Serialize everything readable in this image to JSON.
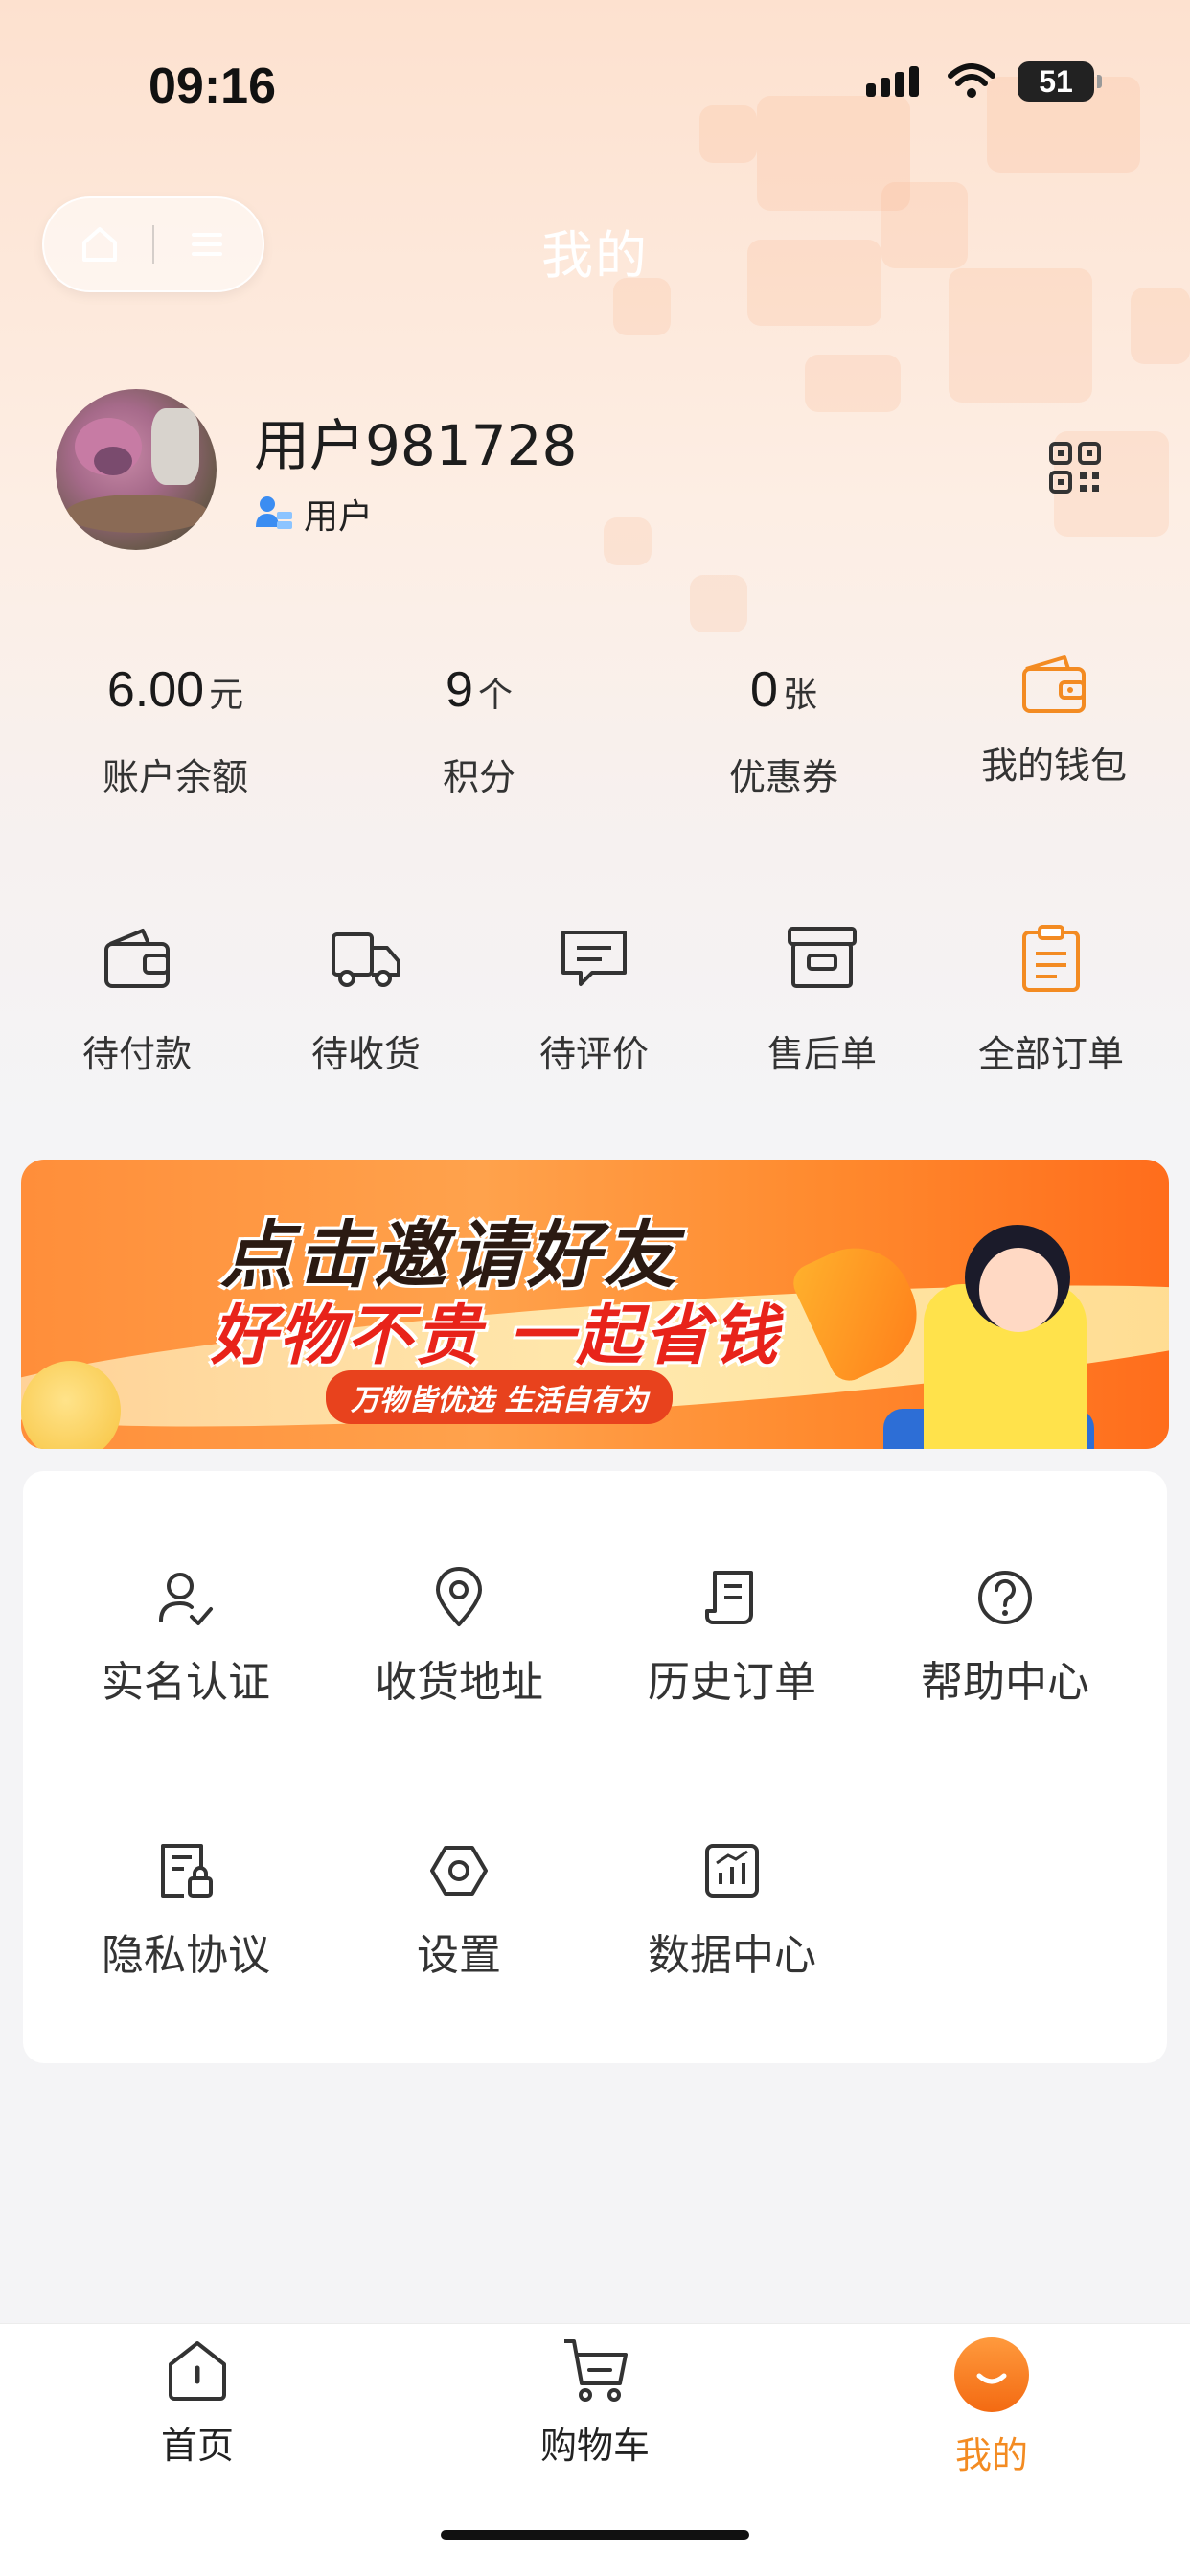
{
  "status_bar": {
    "time": "09:16",
    "battery": "51"
  },
  "nav": {
    "title": "我的"
  },
  "profile": {
    "name": "用户981728",
    "role": "用户"
  },
  "stats": [
    {
      "value": "6.00",
      "unit": "元",
      "label": "账户余额"
    },
    {
      "value": "9",
      "unit": "个",
      "label": "积分"
    },
    {
      "value": "0",
      "unit": "张",
      "label": "优惠券"
    }
  ],
  "wallet": {
    "label": "我的钱包"
  },
  "orders": [
    {
      "label": "待付款",
      "icon": "wallet-icon"
    },
    {
      "label": "待收货",
      "icon": "truck-icon"
    },
    {
      "label": "待评价",
      "icon": "comment-icon"
    },
    {
      "label": "售后单",
      "icon": "archive-icon"
    },
    {
      "label": "全部订单",
      "icon": "clipboard-icon"
    }
  ],
  "banner": {
    "line1": "点击邀请好友",
    "line2": "好物不贵 一起省钱",
    "tagline": "万物皆优选 生活自有为"
  },
  "menu": [
    {
      "label": "实名认证",
      "icon": "user-check-icon"
    },
    {
      "label": "收货地址",
      "icon": "location-pin-icon"
    },
    {
      "label": "历史订单",
      "icon": "receipt-icon"
    },
    {
      "label": "帮助中心",
      "icon": "help-icon"
    },
    {
      "label": "隐私协议",
      "icon": "privacy-doc-icon"
    },
    {
      "label": "设置",
      "icon": "settings-hex-icon"
    },
    {
      "label": "数据中心",
      "icon": "data-chart-icon"
    }
  ],
  "tabbar": [
    {
      "label": "首页",
      "icon": "home-icon",
      "active": false
    },
    {
      "label": "购物车",
      "icon": "cart-icon",
      "active": false
    },
    {
      "label": "我的",
      "icon": "profile-smile-icon",
      "active": true
    }
  ],
  "colors": {
    "accent": "#f38b22",
    "bg": "#f4f4f6"
  }
}
